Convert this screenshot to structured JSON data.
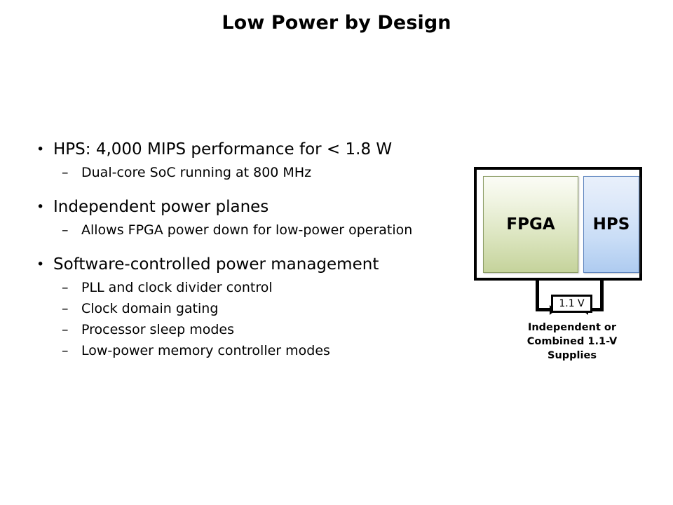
{
  "slide": {
    "title": "Low Power by Design"
  },
  "bullets": [
    {
      "marker": "•",
      "text": "HPS: 4,000 MIPS performance for < 1.8 W",
      "sub": [
        {
          "marker": "–",
          "text": "Dual-core SoC running at 800 MHz"
        }
      ]
    },
    {
      "marker": "•",
      "text": "Independent power planes",
      "sub": [
        {
          "marker": "–",
          "text": "Allows FPGA power down for low-power operation"
        }
      ]
    },
    {
      "marker": "•",
      "text": "Software-controlled power management",
      "sub": [
        {
          "marker": "–",
          "text": "PLL and clock divider control"
        },
        {
          "marker": "–",
          "text": "Clock domain gating"
        },
        {
          "marker": "–",
          "text": "Processor sleep modes"
        },
        {
          "marker": "–",
          "text": "Low-power memory controller modes"
        }
      ]
    }
  ],
  "diagram": {
    "fpga_label": "FPGA",
    "hps_label": "HPS",
    "voltage_label": "1.1 V",
    "caption_line1": "Independent or",
    "caption_line2": "Combined 1.1-V",
    "caption_line3": "Supplies",
    "colors": {
      "fpga_fill_top": "#fbfcf6",
      "fpga_fill_bottom": "#c5d39b",
      "fpga_border": "#8a9b63",
      "hps_fill_top": "#e9f0fb",
      "hps_fill_bottom": "#aecbf0",
      "hps_border": "#5f86bf",
      "outline": "#000000",
      "text": "#000000",
      "background": "#ffffff"
    }
  }
}
